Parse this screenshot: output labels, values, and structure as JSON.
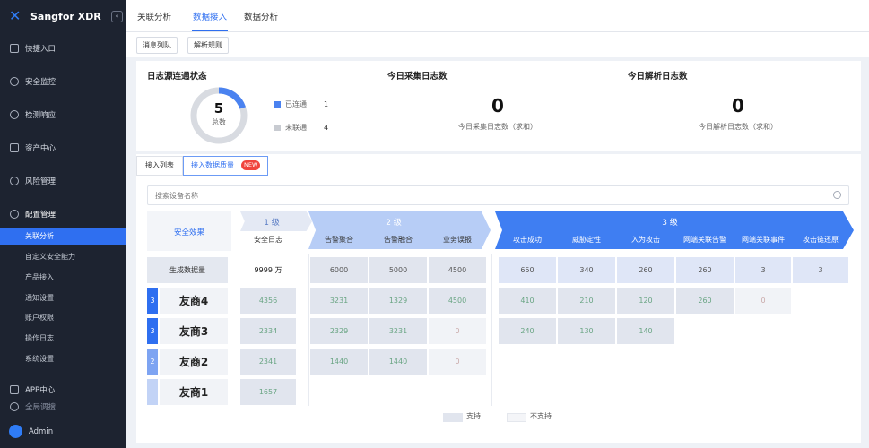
{
  "app": {
    "name": "Sangfor XDR",
    "collapse": "«"
  },
  "sidebar": {
    "items": [
      {
        "label": "快捷入口"
      },
      {
        "label": "安全监控"
      },
      {
        "label": "检测响应"
      },
      {
        "label": "资产中心"
      },
      {
        "label": "风险管理"
      },
      {
        "label": "配置管理"
      }
    ],
    "subitems": [
      {
        "label": "关联分析"
      },
      {
        "label": "自定义安全能力"
      },
      {
        "label": "产品接入"
      },
      {
        "label": "通知设置"
      },
      {
        "label": "账户权限"
      },
      {
        "label": "操作日志"
      },
      {
        "label": "系统设置"
      }
    ],
    "app_center": "APP中心",
    "global_search": "全局调搜",
    "admin": "Admin"
  },
  "tabs": [
    {
      "label": "关联分析"
    },
    {
      "label": "数据接入"
    },
    {
      "label": "数据分析"
    }
  ],
  "subtabs": [
    {
      "label": "消息列队"
    },
    {
      "label": "解析规则"
    }
  ],
  "status": {
    "title": "日志源连通状态",
    "total": "5",
    "total_label": "总数",
    "connected_label": "已连通",
    "connected": "1",
    "disconnected_label": "未联通",
    "disconnected": "4",
    "colors": {
      "connected": "#4a82f0",
      "disconnected": "#c8cbd1"
    }
  },
  "collected": {
    "title": "今日采集日志数",
    "value": "0",
    "label": "今日采集日志数（求和）"
  },
  "parsed": {
    "title": "今日解析日志数",
    "value": "0",
    "label": "今日解析日志数（求和）"
  },
  "lower_tabs": [
    {
      "label": "接入列表"
    },
    {
      "label": "接入数据质量"
    }
  ],
  "badge": "NEW",
  "search": {
    "placeholder": "搜索设备名称"
  },
  "table": {
    "effect_label": "安全效果",
    "level1": "1 级",
    "level2": "2 级",
    "level3": "3 级",
    "col_heads": [
      "安全日志",
      "告警聚合",
      "告警融合",
      "业务误报",
      "攻击成功",
      "威胁定性",
      "入为攻击",
      "网端关联告警",
      "网端关联事件",
      "攻击链还原"
    ],
    "gen_label": "生成数据量",
    "gen_values": [
      "9999 万",
      "6000",
      "5000",
      "4500",
      "650",
      "340",
      "260",
      "260",
      "3",
      "3"
    ],
    "rows": [
      {
        "rank": "3",
        "name": "友商4",
        "values": [
          "4356",
          "3231",
          "1329",
          "4500",
          "410",
          "210",
          "120",
          "260",
          "0"
        ]
      },
      {
        "rank": "3",
        "name": "友商3",
        "values": [
          "2334",
          "2329",
          "3231",
          "0",
          "240",
          "130",
          "140"
        ]
      },
      {
        "rank": "2",
        "name": "友商2",
        "values": [
          "2341",
          "1440",
          "1440",
          "0"
        ]
      },
      {
        "rank": "",
        "name": "友商1",
        "values": [
          "1657"
        ]
      }
    ]
  },
  "legend": {
    "support": "支持",
    "not_support": "不支持"
  }
}
